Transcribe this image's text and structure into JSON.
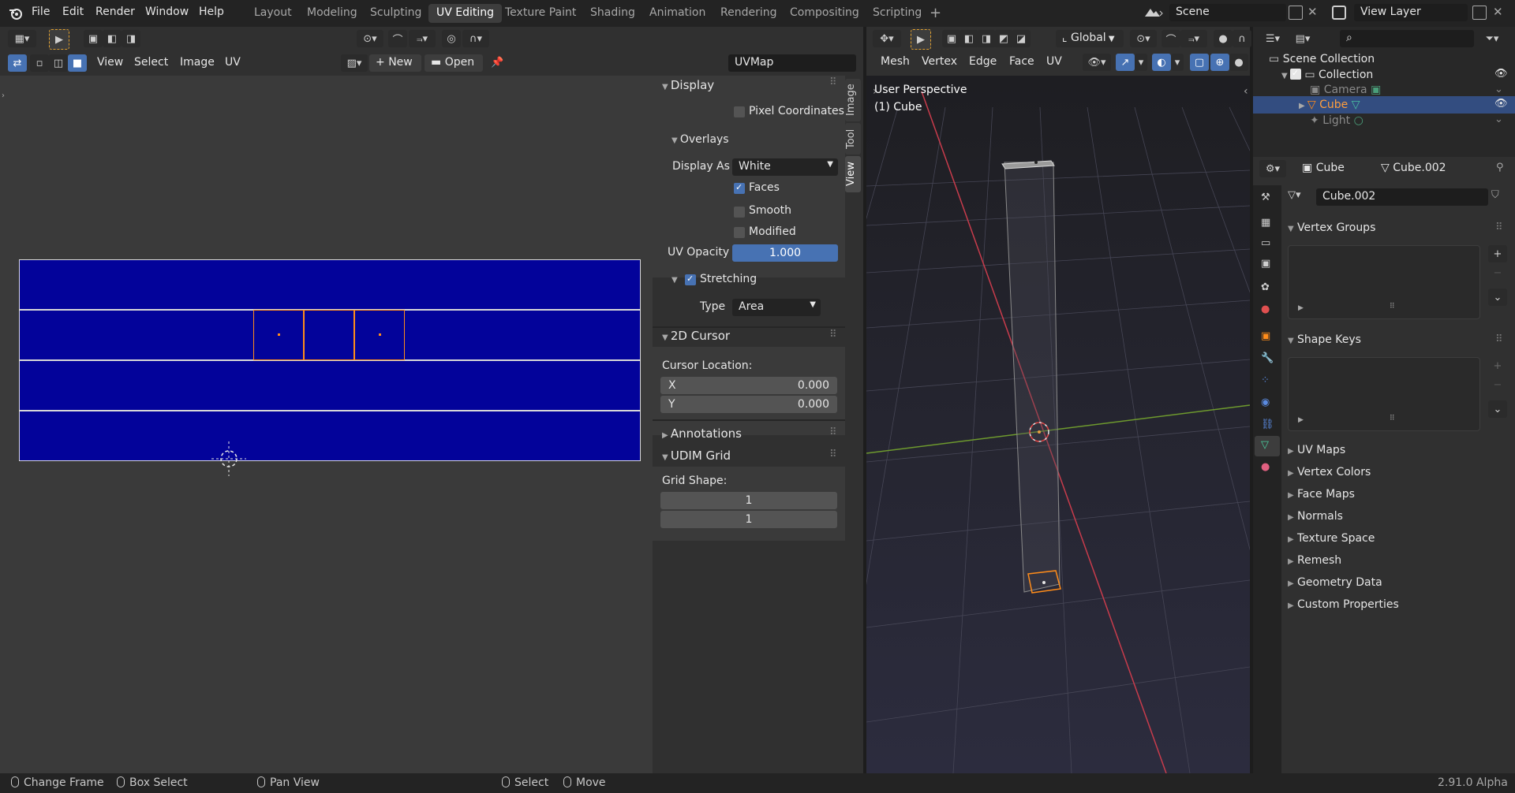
{
  "menu": [
    "File",
    "Edit",
    "Render",
    "Window",
    "Help"
  ],
  "workspaces": [
    "Layout",
    "Modeling",
    "Sculpting",
    "UV Editing",
    "Texture Paint",
    "Shading",
    "Animation",
    "Rendering",
    "Compositing",
    "Scripting"
  ],
  "active_workspace": "UV Editing",
  "scene": "Scene",
  "view_layer": "View Layer",
  "uv_editor": {
    "menus": [
      "View",
      "Select",
      "Image",
      "UV"
    ],
    "new_label": "New",
    "open_label": "Open",
    "uvmap": "UVMap"
  },
  "npanel": {
    "tabs": [
      "Image",
      "Tool",
      "View"
    ],
    "active_tab": "View",
    "display": {
      "title": "Display",
      "pixel_coordinates": "Pixel Coordinates",
      "overlays": "Overlays",
      "display_as_label": "Display As",
      "display_as_value": "White",
      "faces": "Faces",
      "smooth": "Smooth",
      "modified": "Modified",
      "uv_opacity_label": "UV Opacity",
      "uv_opacity_value": "1.000",
      "stretching": "Stretching",
      "type_label": "Type",
      "type_value": "Area"
    },
    "cursor": {
      "title": "2D Cursor",
      "location_label": "Cursor Location:",
      "x_label": "X",
      "x_value": "0.000",
      "y_label": "Y",
      "y_value": "0.000"
    },
    "annotations": "Annotations",
    "udim": {
      "title": "UDIM Grid",
      "grid_shape_label": "Grid Shape:",
      "grid_x": "1",
      "grid_y": "1"
    }
  },
  "viewport": {
    "menus": [
      "Mesh",
      "Vertex",
      "Edge",
      "Face",
      "UV"
    ],
    "orientation": "Global",
    "perspective": "User Perspective",
    "object": "(1) Cube"
  },
  "outliner": {
    "scene_collection": "Scene Collection",
    "collection": "Collection",
    "items": [
      "Camera",
      "Cube",
      "Light"
    ]
  },
  "properties": {
    "object_name": "Cube",
    "mesh_name": "Cube.002",
    "sections": [
      "Vertex Groups",
      "Shape Keys",
      "UV Maps",
      "Vertex Colors",
      "Face Maps",
      "Normals",
      "Texture Space",
      "Remesh",
      "Geometry Data",
      "Custom Properties"
    ]
  },
  "status": {
    "change_frame": "Change Frame",
    "box_select": "Box Select",
    "pan_view": "Pan View",
    "select": "Select",
    "move": "Move",
    "version": "2.91.0 Alpha"
  },
  "colors": {
    "accent": "#4772b3",
    "uv_fill": "#03039a",
    "selected_edge": "#ff8c1a"
  }
}
